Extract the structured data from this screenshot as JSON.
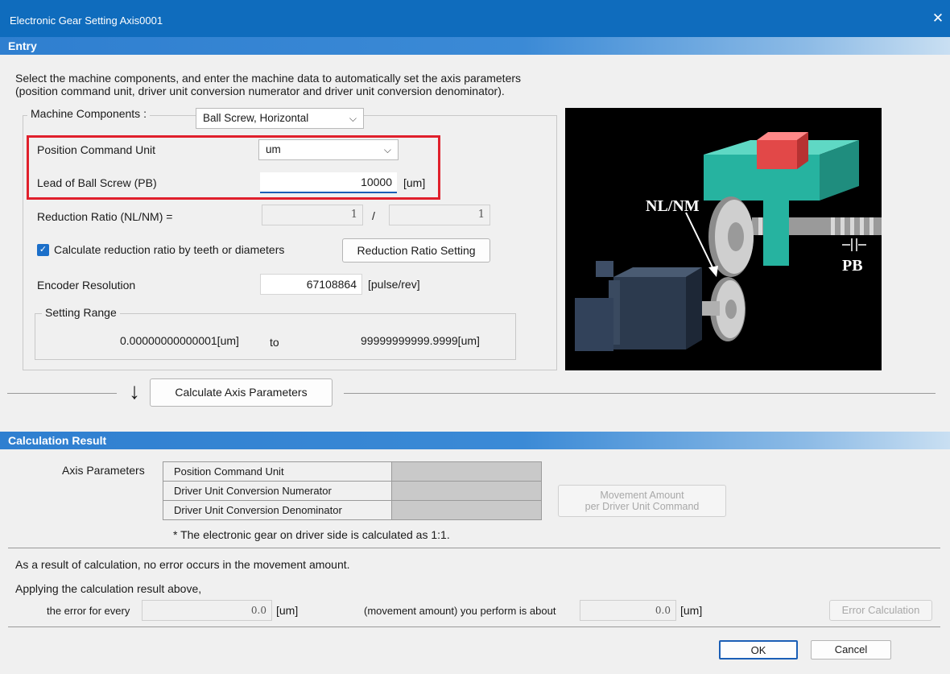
{
  "window": {
    "title": "Electronic Gear Setting Axis0001",
    "close_icon": "close-icon"
  },
  "entry": {
    "header": "Entry",
    "description_line1": "Select the machine components, and enter the machine data to automatically set the axis parameters",
    "description_line2": "(position command unit, driver unit conversion numerator and driver unit conversion denominator).",
    "machine_components_label": "Machine Components :",
    "machine_components_value": "Ball Screw, Horizontal",
    "position_command_unit_label": "Position Command Unit",
    "position_command_unit_value": "um",
    "lead_label": "Lead of Ball Screw (PB)",
    "lead_value": "10000",
    "lead_unit": "[um]",
    "reduction_label": "Reduction Ratio (NL/NM) =",
    "reduction_numerator": "1",
    "reduction_separator": "/",
    "reduction_denominator": "1",
    "calc_checkbox_label": "Calculate reduction ratio by teeth or diameters",
    "calc_checkbox_checked": true,
    "reduction_button": "Reduction Ratio Setting",
    "encoder_label": "Encoder Resolution",
    "encoder_value": "67108864",
    "encoder_unit": "[pulse/rev]",
    "setting_range_label": "Setting Range",
    "range_min": "0.00000000000001[um]",
    "range_to": "to",
    "range_max": "99999999999.9999[um]",
    "image_labels": {
      "nl_nm": "NL/NM",
      "pb": "PB"
    },
    "calculate_button": "Calculate Axis Parameters"
  },
  "result": {
    "header": "Calculation Result",
    "axis_parameters_label": "Axis Parameters",
    "rows": [
      {
        "label": "Position Command Unit",
        "value": ""
      },
      {
        "label": "Driver Unit Conversion Numerator",
        "value": ""
      },
      {
        "label": "Driver Unit Conversion Denominator",
        "value": ""
      }
    ],
    "movement_button_line1": "Movement Amount",
    "movement_button_line2": "per Driver Unit Command",
    "footnote": "* The electronic gear on driver side is calculated as 1:1.",
    "message": "As a result of calculation, no error occurs in the movement amount.",
    "applying": "Applying the calculation result above,",
    "error_every_label": "the error for every",
    "error_every_value": "0.0",
    "error_every_unit": "[um]",
    "movement_label": "(movement amount) you perform is about",
    "movement_value": "0.0",
    "movement_unit": "[um]",
    "error_calc_button": "Error Calculation"
  },
  "footer": {
    "ok": "OK",
    "cancel": "Cancel"
  },
  "colors": {
    "titlebar": "#0f6cbd",
    "highlight": "#e0202c",
    "checkbox": "#1b6fc9",
    "slider_table": "#2ab7a5"
  }
}
